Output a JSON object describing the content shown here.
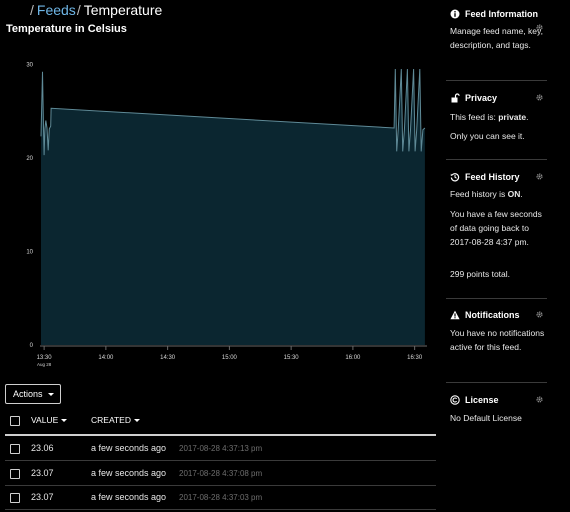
{
  "breadcrumb": {
    "sep": "/",
    "feeds_label": "Feeds",
    "current": "Temperature"
  },
  "chart_title": "Temperature in Celsius",
  "chart_data": {
    "type": "area",
    "title": "Temperature in Celsius",
    "y_ticks": [
      "30",
      "20",
      "10",
      "0"
    ],
    "ylim": [
      0,
      31
    ],
    "x_ticks": [
      "13:30",
      "14:00",
      "14:30",
      "15:00",
      "15:30",
      "16:00",
      "16:30"
    ],
    "x_tick_sublabel": "Aug 28",
    "x_tick_minutes": [
      0,
      30,
      60,
      90,
      120,
      150,
      180
    ],
    "xlim_minutes": [
      -2,
      186
    ],
    "series": [
      {
        "points": [
          [
            -1.5,
            22.3
          ],
          [
            -0.8,
            29.2
          ],
          [
            -0.3,
            23.2
          ],
          [
            0.0,
            20.3
          ],
          [
            0.4,
            23.1
          ],
          [
            0.8,
            24.0
          ],
          [
            1.4,
            23.2
          ],
          [
            2.0,
            20.8
          ],
          [
            2.5,
            23.1
          ],
          [
            3.2,
            23.4
          ],
          [
            3.4,
            25.3
          ],
          [
            170.0,
            23.2
          ],
          [
            170.6,
            29.5
          ],
          [
            171.3,
            20.7
          ],
          [
            172.0,
            23.0
          ],
          [
            173.5,
            29.5
          ],
          [
            174.2,
            20.7
          ],
          [
            175.0,
            23.0
          ],
          [
            176.5,
            29.5
          ],
          [
            177.2,
            20.7
          ],
          [
            178.0,
            23.0
          ],
          [
            179.5,
            29.5
          ],
          [
            180.2,
            20.7
          ],
          [
            181.0,
            23.0
          ],
          [
            182.5,
            29.5
          ],
          [
            183.2,
            20.7
          ],
          [
            184.0,
            23.0
          ],
          [
            185.0,
            23.2
          ]
        ]
      }
    ],
    "fill_color": "#0b2630",
    "line_color": "#5f8a97"
  },
  "actions": {
    "label": "Actions"
  },
  "table": {
    "columns": [
      "VALUE",
      "CREATED"
    ],
    "rows": [
      {
        "value": "23.06",
        "ago": "a few seconds ago",
        "timestamp": "2017-08-28 4:37:13 pm"
      },
      {
        "value": "23.07",
        "ago": "a few seconds ago",
        "timestamp": "2017-08-28 4:37:08 pm"
      },
      {
        "value": "23.07",
        "ago": "a few seconds ago",
        "timestamp": "2017-08-28 4:37:03 pm"
      }
    ]
  },
  "sidebar": {
    "feed_information": {
      "title": "Feed Information",
      "text": "Manage feed name, key, description, and tags."
    },
    "privacy": {
      "title": "Privacy",
      "text_prefix": "This feed is:",
      "status": "private",
      "status_suffix": ".",
      "note": "Only you can see it."
    },
    "feed_history": {
      "title": "Feed History",
      "status_prefix": "Feed history is",
      "status": "ON",
      "status_suffix": ".",
      "detail": "You have a few seconds of data going back to 2017-08-28 4:37 pm.",
      "points": "299 points total."
    },
    "notifications": {
      "title": "Notifications",
      "text": "You have no notifications active for this feed."
    },
    "license": {
      "title": "License",
      "text": "No Default License"
    }
  }
}
